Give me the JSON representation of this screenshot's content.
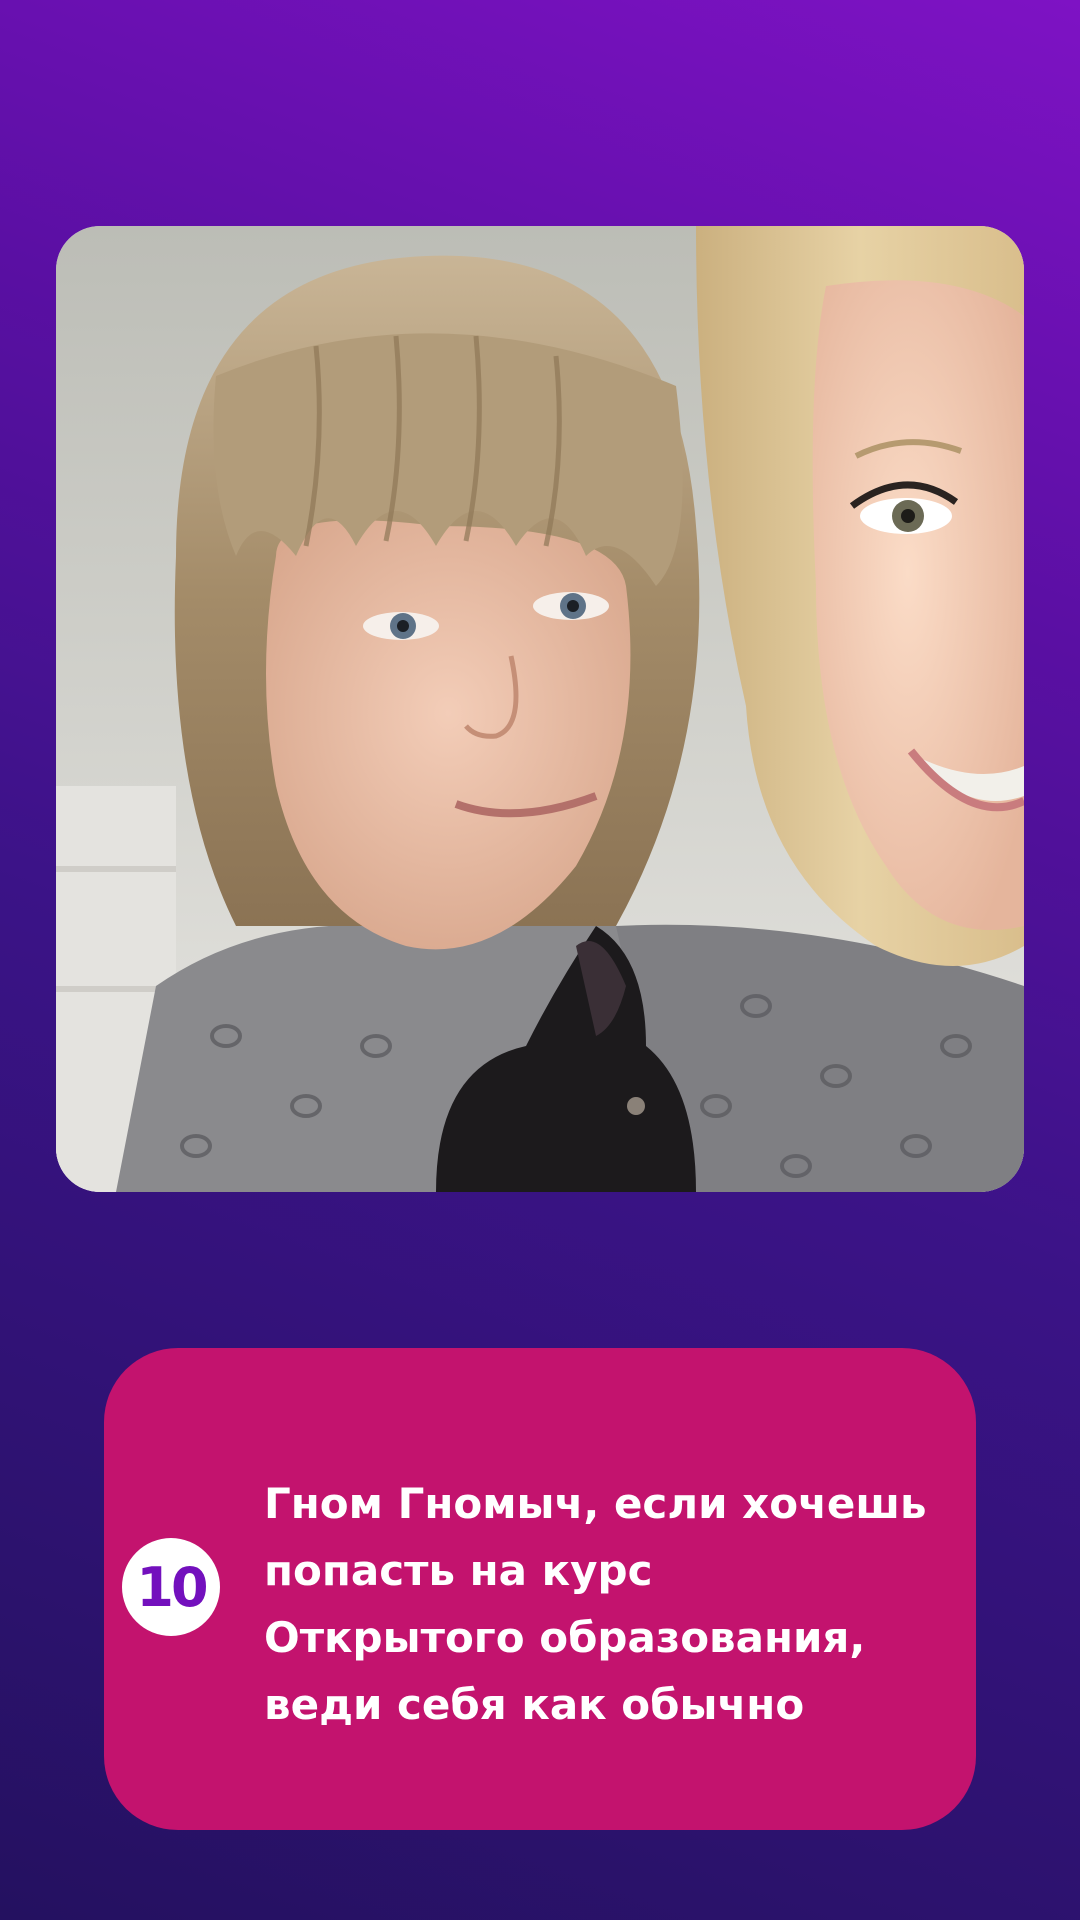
{
  "photo": {
    "alt": "Photo: a child with a blonde bob haircut next to a smiling blonde woman, a small black dog at the bottom"
  },
  "caption": {
    "number": "10",
    "lines": [
      "Гном Гномыч, если хочешь",
      "попасть на курс",
      "Открытого образования,",
      "веди себя как обычно"
    ]
  },
  "colors": {
    "background_top": "#7e12c4",
    "background_bottom": "#241160",
    "caption_card": "#c3136e",
    "badge_text": "#7310bd",
    "caption_text": "#ffffff"
  }
}
